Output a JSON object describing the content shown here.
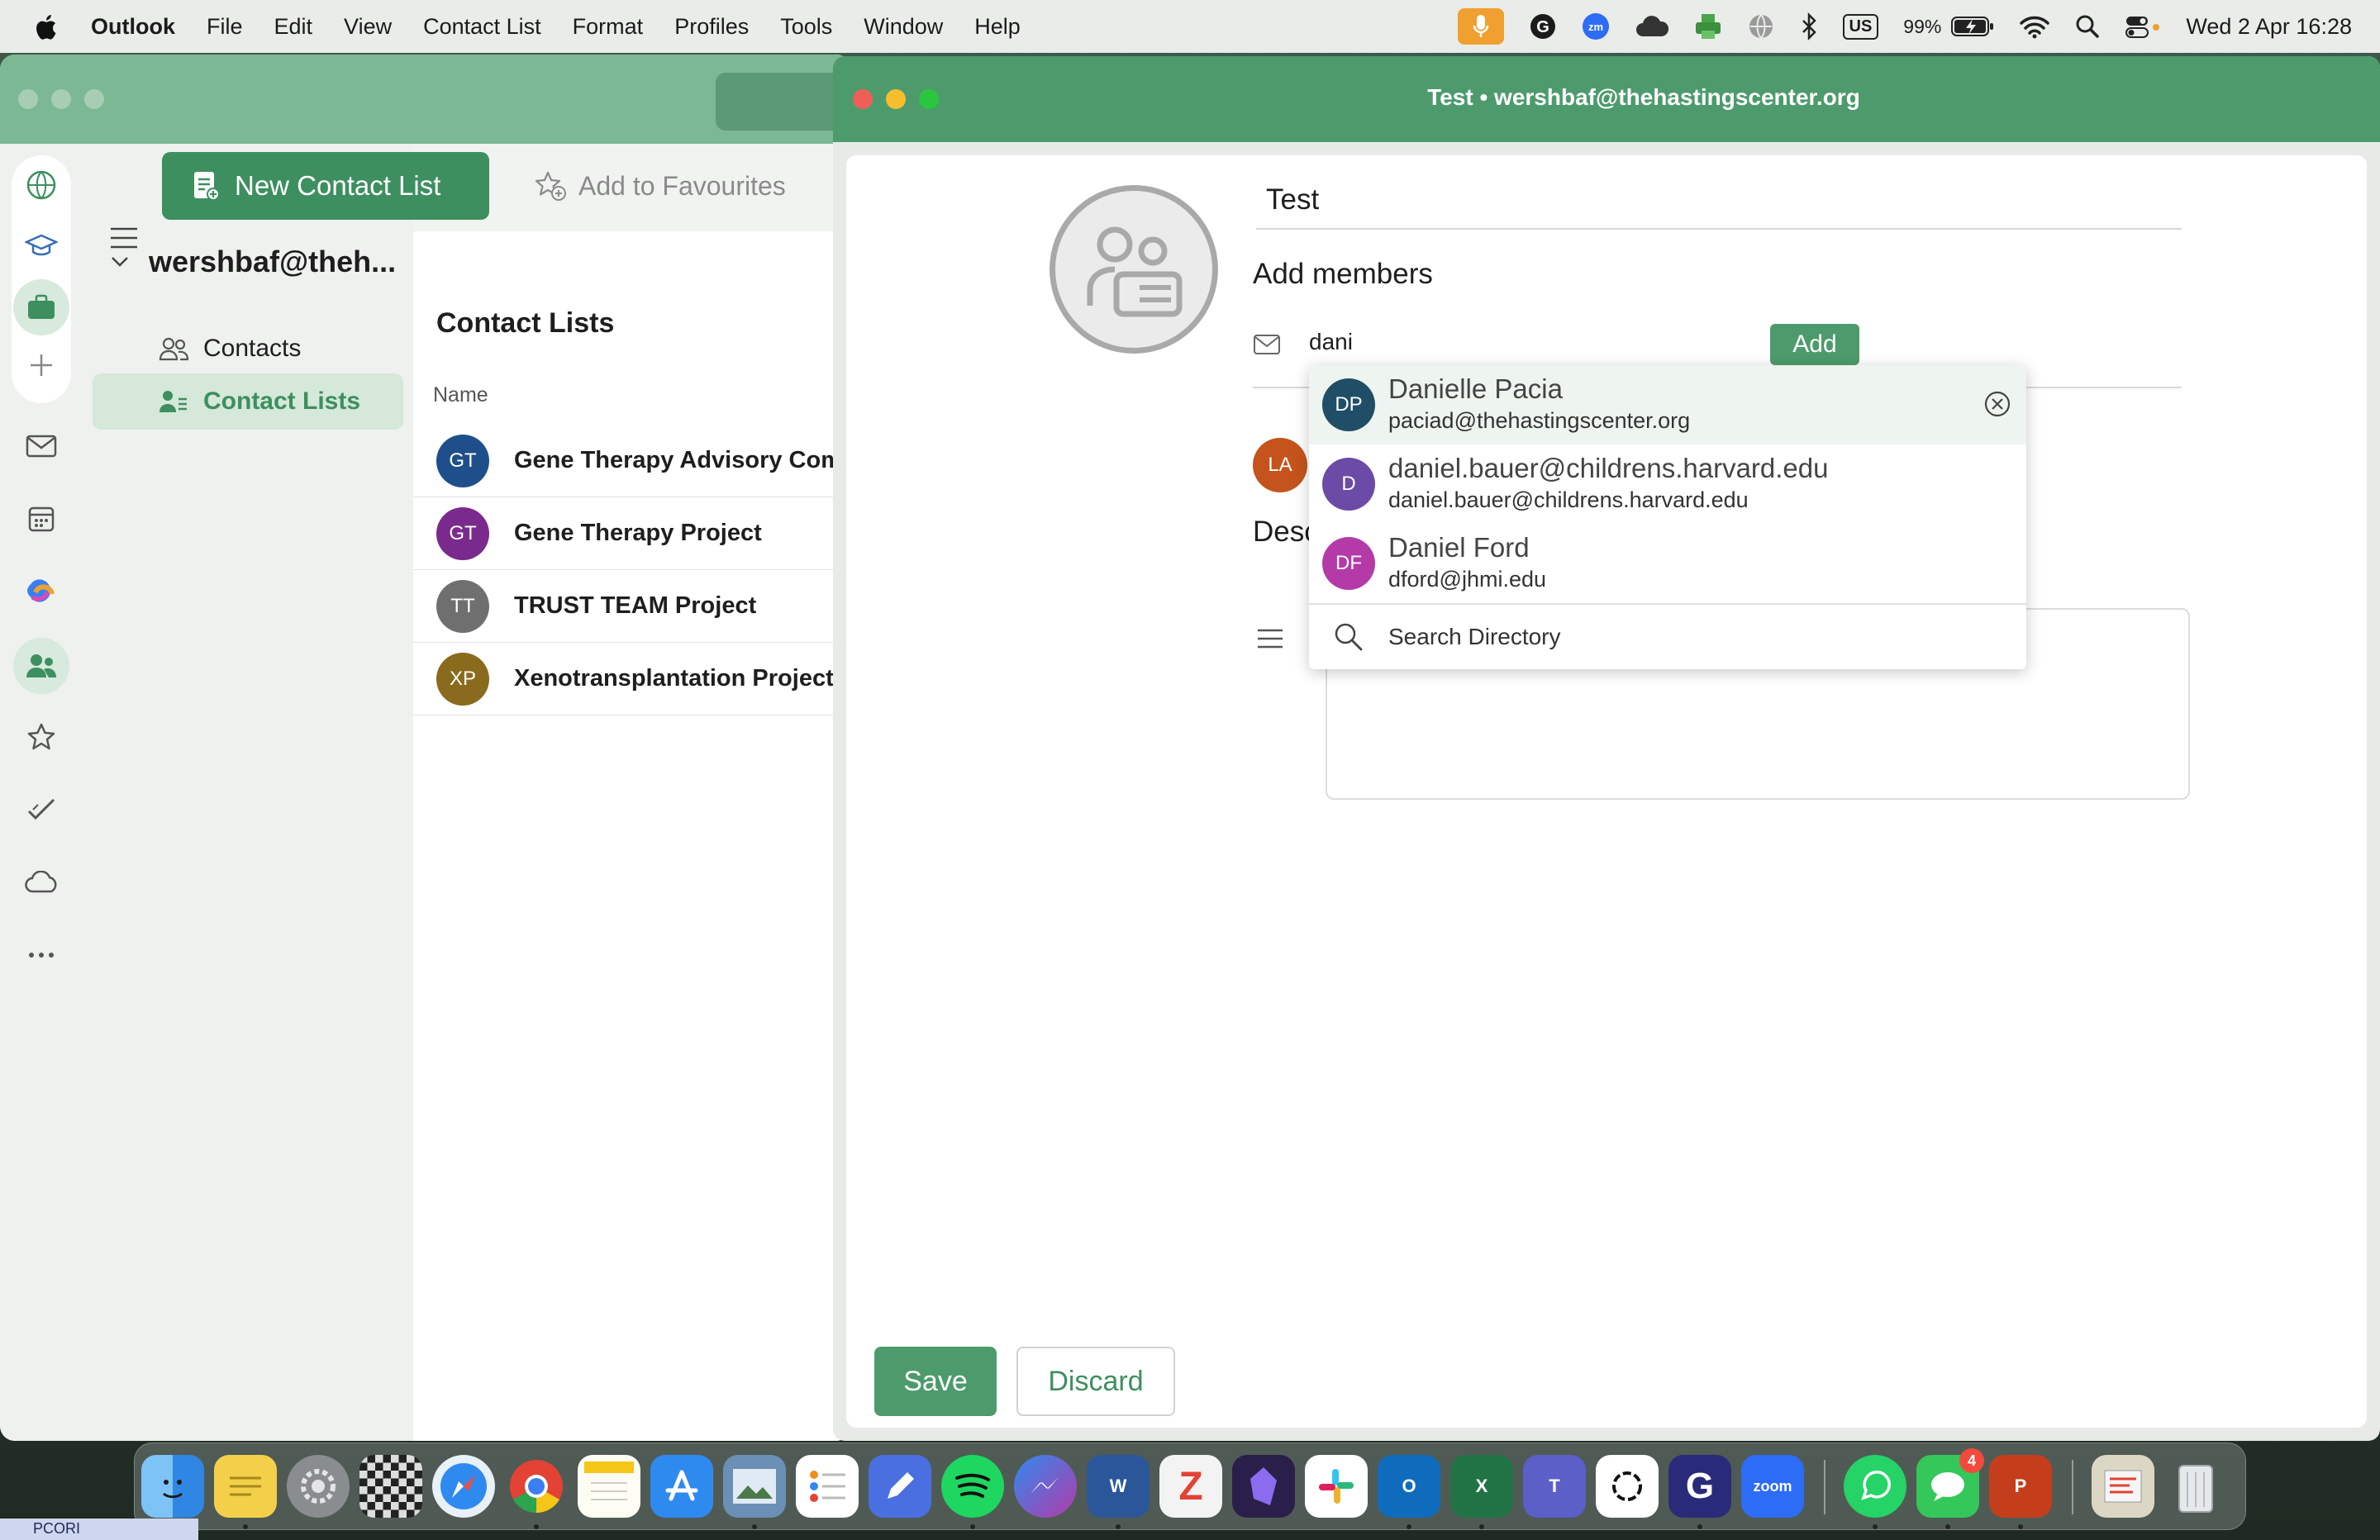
{
  "menubar": {
    "app_name": "Outlook",
    "menus": [
      "File",
      "Edit",
      "View",
      "Contact List",
      "Format",
      "Profiles",
      "Tools",
      "Window",
      "Help"
    ],
    "battery": "99%",
    "keyboard": "US",
    "datetime": "Wed 2 Apr  16:28"
  },
  "toolbar": {
    "new_contact_list": "New Contact List",
    "add_to_favourites": "Add to Favourites"
  },
  "nav": {
    "account": "wershbaf@theh...",
    "items": [
      {
        "label": "Contacts",
        "icon": "people-icon"
      },
      {
        "label": "Contact Lists",
        "icon": "contact-list-icon",
        "selected": true
      }
    ]
  },
  "contact_lists": {
    "title": "Contact Lists",
    "column_header": "Name",
    "rows": [
      {
        "initials": "GT",
        "name": "Gene Therapy Advisory Comm",
        "color": "#1e4f8a"
      },
      {
        "initials": "GT",
        "name": "Gene Therapy Project",
        "color": "#7a2a8c"
      },
      {
        "initials": "TT",
        "name": "TRUST TEAM Project",
        "color": "#6f6f6f"
      },
      {
        "initials": "XP",
        "name": "Xenotransplantation Project",
        "color": "#8a6a1c"
      }
    ]
  },
  "compose": {
    "window_title": "Test • wershbaf@thehastingscenter.org",
    "list_name": "Test",
    "add_members_label": "Add members",
    "member_input_value": "dani",
    "add_button": "Add",
    "existing_member_initials": "LA",
    "description_label": "Desc",
    "save": "Save",
    "discard": "Discard"
  },
  "suggestions": {
    "items": [
      {
        "initials": "DP",
        "name": "Danielle Pacia",
        "email": "paciad@thehastingscenter.org",
        "color": "#1f4e66"
      },
      {
        "initials": "D",
        "name": "daniel.bauer@childrens.harvard.edu",
        "email": "daniel.bauer@childrens.harvard.edu",
        "color": "#6b4ba6"
      },
      {
        "initials": "DF",
        "name": "Daniel Ford",
        "email": "dford@jhmi.edu",
        "color": "#b43aa8"
      }
    ],
    "search_directory": "Search Directory"
  },
  "dock": {
    "zoom_label": "zoom",
    "messages_badge": "4"
  },
  "bottom_label": "PCORI",
  "colors": {
    "accent": "#3d8f5f",
    "title_bar": "#4d9b6c",
    "selected_nav": "#d5e8da"
  }
}
